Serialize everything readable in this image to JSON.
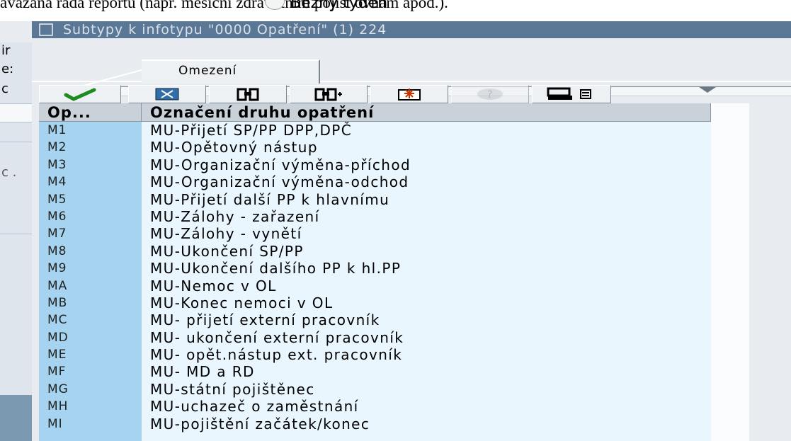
{
  "background": {
    "doc_text": "avazana rada reportu (napr. mesicni zdravotnim pojist ovnam apod.).",
    "radio_label": "Bezny tyden",
    "left_labels": [
      "ir",
      "e:",
      "c",
      "c ."
    ]
  },
  "dialog": {
    "title": "Subtypy k infotypu \"0000 Opatření\" (1)  224",
    "tab_label": "Omezení"
  },
  "toolbar": {
    "buttons": [
      {
        "name": "confirm-button",
        "glyph": "✔"
      },
      {
        "name": "cancel-button",
        "glyph": "✖"
      },
      {
        "name": "find-button",
        "glyph": "▦"
      },
      {
        "name": "find-next-button",
        "glyph": "▦+"
      },
      {
        "name": "new-entry-button",
        "glyph": "✱"
      },
      {
        "name": "help-button",
        "glyph": "?"
      },
      {
        "name": "print-button",
        "glyph": "⎙ ▤"
      }
    ]
  },
  "columns": {
    "key_header": "Op...",
    "text_header": "Označení druhu opatření"
  },
  "rows": [
    {
      "key": "M1",
      "text": "MU-Přijetí SP/PP DPP,DPČ"
    },
    {
      "key": "M2",
      "text": "MU-Opětovný nástup"
    },
    {
      "key": "M3",
      "text": "MU-Organizační výměna-příchod"
    },
    {
      "key": "M4",
      "text": "MU-Organizační výměna-odchod"
    },
    {
      "key": "M5",
      "text": "MU-Přijetí další PP k hlavnímu"
    },
    {
      "key": "M6",
      "text": "MU-Zálohy - zařazení"
    },
    {
      "key": "M7",
      "text": "MU-Zálohy - vynětí"
    },
    {
      "key": "M8",
      "text": "MU-Ukončení SP/PP"
    },
    {
      "key": "M9",
      "text": "MU-Ukončení dalšího PP k hl.PP"
    },
    {
      "key": "MA",
      "text": "MU-Nemoc v OL"
    },
    {
      "key": "MB",
      "text": "MU-Konec nemoci v OL"
    },
    {
      "key": "MC",
      "text": "MU- přijetí externí pracovník"
    },
    {
      "key": "MD",
      "text": "MU- ukončení externí pracovník"
    },
    {
      "key": "ME",
      "text": "MU- opět.nástup ext. pracovník"
    },
    {
      "key": "MF",
      "text": "MU- MD a RD"
    },
    {
      "key": "MG",
      "text": "MU-státní pojištěnec"
    },
    {
      "key": "MH",
      "text": "MU-uchazeč o zaměstnání"
    },
    {
      "key": "MI",
      "text": "MU-pojištění začátek/konec"
    }
  ]
}
